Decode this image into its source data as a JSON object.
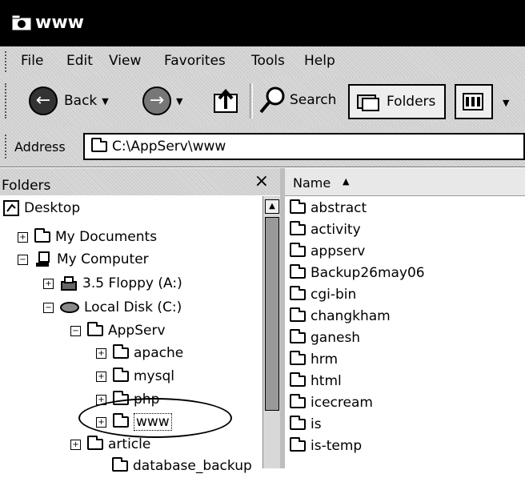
{
  "window": {
    "title": "www"
  },
  "menu": {
    "items": [
      "File",
      "Edit",
      "View",
      "Favorites",
      "Tools",
      "Help"
    ]
  },
  "toolbar": {
    "back_label": "Back",
    "search_label": "Search",
    "folders_label": "Folders"
  },
  "address": {
    "label": "Address",
    "value": "C:\\AppServ\\www"
  },
  "folders_pane": {
    "title": "Folders",
    "close": "×",
    "tree": [
      {
        "label": "Desktop",
        "expander": ""
      },
      {
        "label": "My Documents",
        "expander": "+"
      },
      {
        "label": "My Computer",
        "expander": "−"
      },
      {
        "label": "3.5 Floppy (A:)",
        "expander": "+"
      },
      {
        "label": "Local Disk (C:)",
        "expander": "−"
      },
      {
        "label": "AppServ",
        "expander": "−"
      },
      {
        "label": "apache",
        "expander": "+"
      },
      {
        "label": "mysql",
        "expander": "+"
      },
      {
        "label": "php",
        "expander": "+"
      },
      {
        "label": "www",
        "expander": "+"
      },
      {
        "label": "article",
        "expander": "+"
      },
      {
        "label": "database_backup",
        "expander": ""
      }
    ]
  },
  "file_list": {
    "column_name": "Name",
    "sort_indicator": "▲",
    "items": [
      "abstract",
      "activity",
      "appserv",
      "Backup26may06",
      "cgi-bin",
      "changkham",
      "ganesh",
      "hrm",
      "html",
      "icecream",
      "is",
      "is-temp"
    ]
  },
  "icons": {
    "window": "folder-window-icon",
    "back": "back-arrow-icon",
    "forward": "forward-arrow-icon",
    "up": "up-folder-icon",
    "search": "magnifier-icon",
    "folders": "folders-icon",
    "views": "views-icon",
    "folder": "folder-icon"
  }
}
